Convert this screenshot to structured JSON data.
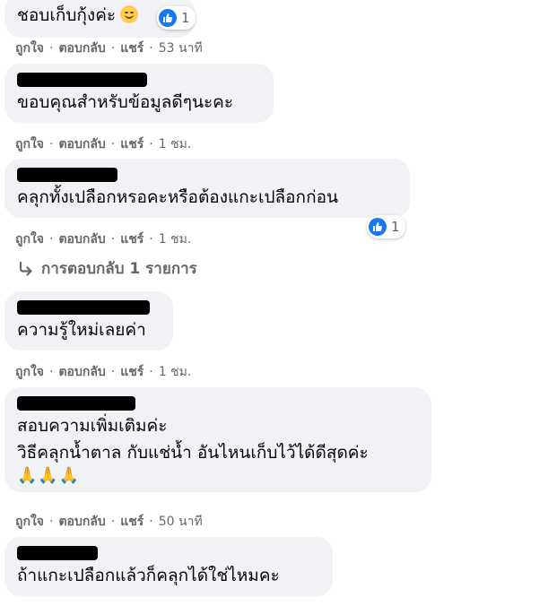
{
  "actions": {
    "like": "ถูกใจ",
    "reply": "ตอบกลับ",
    "share": "แชร์",
    "sep": "·"
  },
  "comments": [
    {
      "text": "ชอบเก็บกุ้งค่ะ",
      "emoji": "smiling-face-emoji",
      "reactions": "1",
      "time": "53 นาที"
    },
    {
      "text": "ขอบคุณสำหรับข้อมูลดีๆนะคะ",
      "time": "1 ชม."
    },
    {
      "text": "คลุกทั้งเปลือกหรอคะหรือต้องแกะเปลือกก่อน",
      "reactions": "1",
      "time": "1 ชม."
    },
    {
      "text": "ความรู้ใหม่เลยค่า",
      "time": "1 ชม."
    },
    {
      "text": "สอบความเพิ่มเติมค่ะ\nวิธีคลุกน้ำตาล กับแช่น้ำ อันไหนเก็บไว้ได้ดีสุดค่ะ",
      "emoji_line": "🙏🙏🙏",
      "time": "50 นาที"
    },
    {
      "text": "ถ้าแกะเปลือกแล้วก็คลุกได้ใช่ไหมคะ"
    }
  ],
  "replies_link": "การตอบกลับ 1 รายการ",
  "icons": {
    "like": "like-icon",
    "reply_arrow": "reply-arrow-icon"
  },
  "colors": {
    "bubble": "#f0f2f5",
    "meta_text": "#65676b",
    "like_blue": "#1877f2"
  }
}
